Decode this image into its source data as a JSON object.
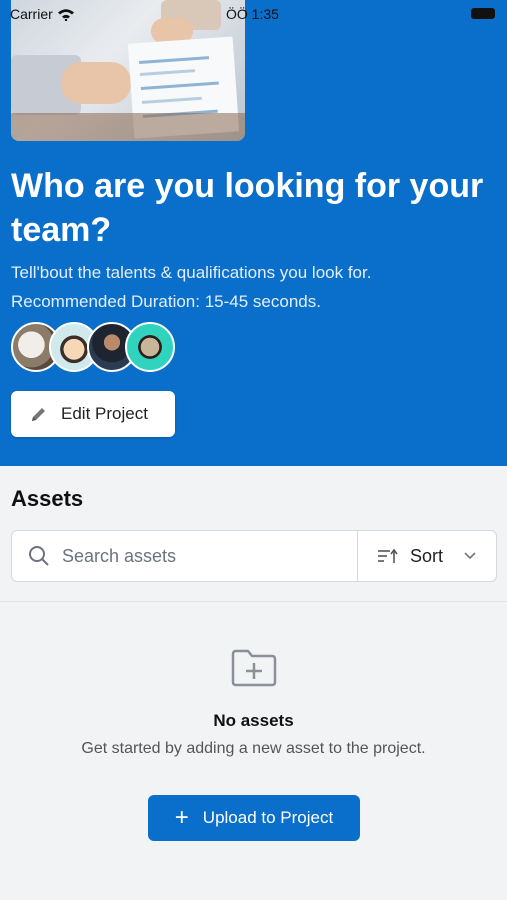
{
  "status_bar": {
    "carrier": "Carrier",
    "time": "ÖÖ 1:35"
  },
  "hero": {
    "title": "Who are you looking for your team?",
    "subtitle_line1": "Tell'bout the talents & qualifications you look for.",
    "subtitle_line2": "Recommended Duration: 15-45 seconds.",
    "edit_button": "Edit Project"
  },
  "assets": {
    "title": "Assets",
    "search_placeholder": "Search assets",
    "sort_label": "Sort",
    "empty_title": "No assets",
    "empty_description": "Get started by adding a new asset to the project.",
    "upload_button": "Upload to Project"
  },
  "colors": {
    "brand_blue": "#0a6fca",
    "page_bg": "#f2f3f5"
  },
  "icons": [
    "wifi-icon",
    "battery-icon",
    "pencil-icon",
    "search-icon",
    "sort-icon",
    "chevron-down-icon",
    "folder-plus-icon",
    "plus-icon"
  ]
}
